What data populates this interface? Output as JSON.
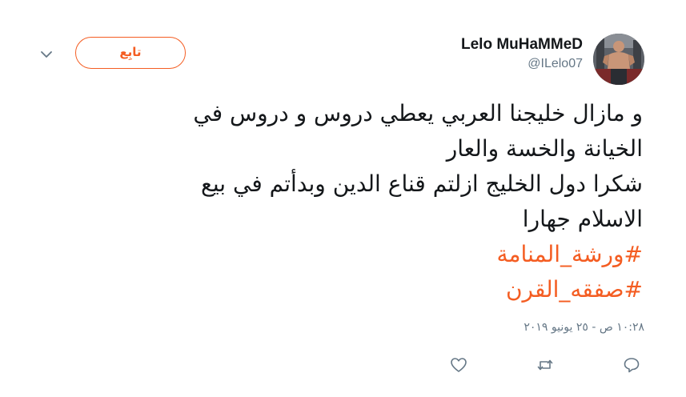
{
  "author": {
    "display_name": "Lelo MuHaMMeD",
    "handle": "@ILelo07"
  },
  "follow_button": {
    "label": "تابِع"
  },
  "tweet": {
    "lines": [
      "و مازال خليجنا العربي يعطي دروس و دروس في",
      "الخيانة والخسة والعار",
      "شكرا دول الخليج ازلتم قناع الدين وبدأتم في بيع",
      "الاسلام جهارا"
    ],
    "hashtags": [
      "#ورشة_المنامة",
      "#صفقه_القرن"
    ],
    "timestamp": "١٠:٢٨ ص - ٢٥ يونيو ٢٠١٩"
  },
  "icons": {
    "caret": "chevron-down-icon",
    "like": "heart-icon",
    "retweet": "retweet-icon",
    "reply": "reply-icon"
  },
  "colors": {
    "accent": "#f45d22",
    "text": "#14171a",
    "secondary": "#657786"
  }
}
